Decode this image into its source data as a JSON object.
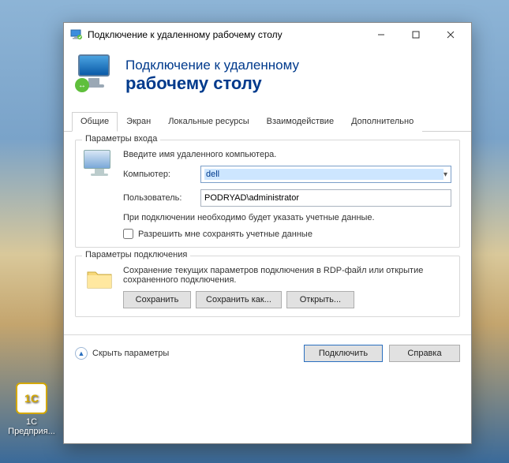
{
  "desktop": {
    "icon_label_line1": "1С",
    "icon_label_line2": "Предприя...",
    "icon_glyph": "1C"
  },
  "window": {
    "title": "Подключение к удаленному рабочему столу"
  },
  "header": {
    "line1": "Подключение к удаленному",
    "line2": "рабочему столу"
  },
  "tabs": [
    {
      "label": "Общие",
      "active": true
    },
    {
      "label": "Экран",
      "active": false
    },
    {
      "label": "Локальные ресурсы",
      "active": false
    },
    {
      "label": "Взаимодействие",
      "active": false
    },
    {
      "label": "Дополнительно",
      "active": false
    }
  ],
  "login_group": {
    "title": "Параметры входа",
    "hint": "Введите имя удаленного компьютера.",
    "computer_label": "Компьютер:",
    "computer_value": "dell",
    "user_label": "Пользователь:",
    "user_value": "PODRYAD\\administrator",
    "info": "При подключении необходимо будет указать учетные данные.",
    "save_creds_label": "Разрешить мне сохранять учетные данные"
  },
  "conn_group": {
    "title": "Параметры подключения",
    "descr": "Сохранение текущих параметров подключения в RDP-файл или открытие сохраненного подключения.",
    "save": "Сохранить",
    "save_as": "Сохранить как...",
    "open": "Открыть..."
  },
  "footer": {
    "collapse": "Скрыть параметры",
    "connect": "Подключить",
    "help": "Справка"
  }
}
